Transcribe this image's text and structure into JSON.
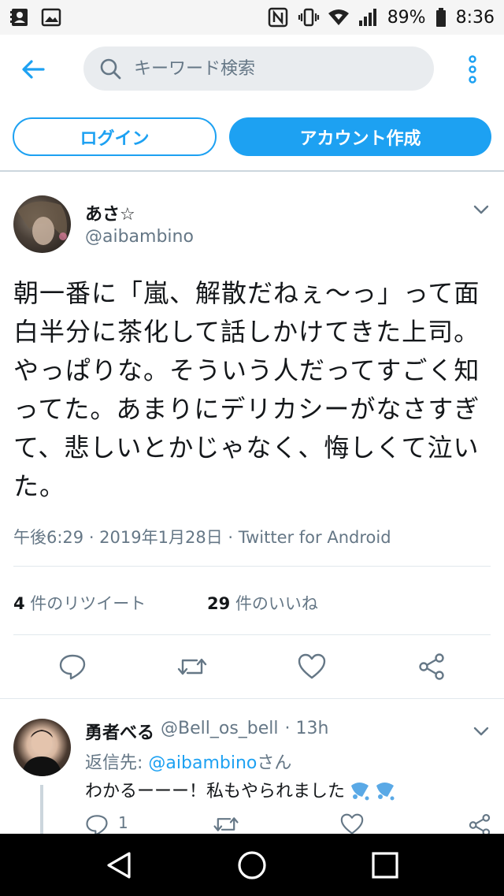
{
  "status_bar": {
    "battery": "89%",
    "time": "8:36"
  },
  "search": {
    "placeholder": "キーワード検索"
  },
  "auth": {
    "login_label": "ログイン",
    "signup_label": "アカウント作成"
  },
  "tweet": {
    "author_name": "あさ☆",
    "author_handle": "@aibambino",
    "text": "朝一番に「嵐、解散だねぇ〜っ」って面白半分に茶化して話しかけてきた上司。やっぱりな。そういう人だってすごく知ってた。あまりにデリカシーがなさすぎて、悲しいとかじゃなく、悔しくて泣いた。",
    "meta": "午後6:29 · 2019年1月28日 · Twitter for Android",
    "retweet_count": "4",
    "retweet_label": " 件のリツイート",
    "like_count": "29",
    "like_label": " 件のいいね"
  },
  "reply": {
    "author_name": "勇者べる",
    "author_handle": "@Bell_os_bell",
    "time": "· 13h",
    "reply_to_prefix": "返信先: ",
    "reply_to_handle": "@aibambino",
    "reply_to_suffix": "さん",
    "text": "わかるーーー！私もやられました",
    "reply_count": "1"
  },
  "icons": {
    "accent": "#1da1f2",
    "secondary": "#657786"
  }
}
